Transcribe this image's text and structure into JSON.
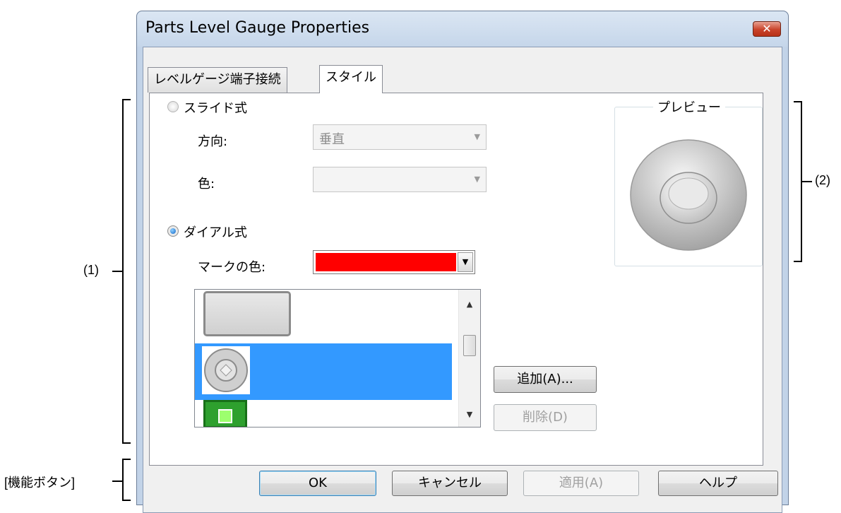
{
  "window": {
    "title": "Parts Level Gauge Properties",
    "close_symbol": "✕"
  },
  "tabs": [
    {
      "label": "レベルゲージ端子接続",
      "active": false
    },
    {
      "label": "スタイル",
      "active": true
    }
  ],
  "style": {
    "slide": {
      "label": "スライド式",
      "selected": false,
      "direction_label": "方向:",
      "direction_value": "垂直",
      "color_label": "色:",
      "color_value": ""
    },
    "dial": {
      "label": "ダイアル式",
      "selected": true,
      "mark_color_label": "マークの色:",
      "mark_color": "#ff0000"
    },
    "image_list": {
      "items": [
        {
          "icon": "gray-panel-image",
          "selected": false
        },
        {
          "icon": "dial-knob-image",
          "selected": true
        },
        {
          "icon": "green-led-image",
          "selected": false
        }
      ]
    },
    "add_button": "追加(A)...",
    "delete_button": "削除(D)",
    "preview_label": "プレビュー"
  },
  "buttons": {
    "ok": "OK",
    "cancel": "キャンセル",
    "apply": "適用(A)",
    "help": "ヘルプ"
  },
  "annotations": {
    "area1": "(1)",
    "area2": "(2)",
    "function_buttons": "[機能ボタン]"
  },
  "colors": {
    "selection": "#3399ff",
    "mark": "#ff0000"
  }
}
